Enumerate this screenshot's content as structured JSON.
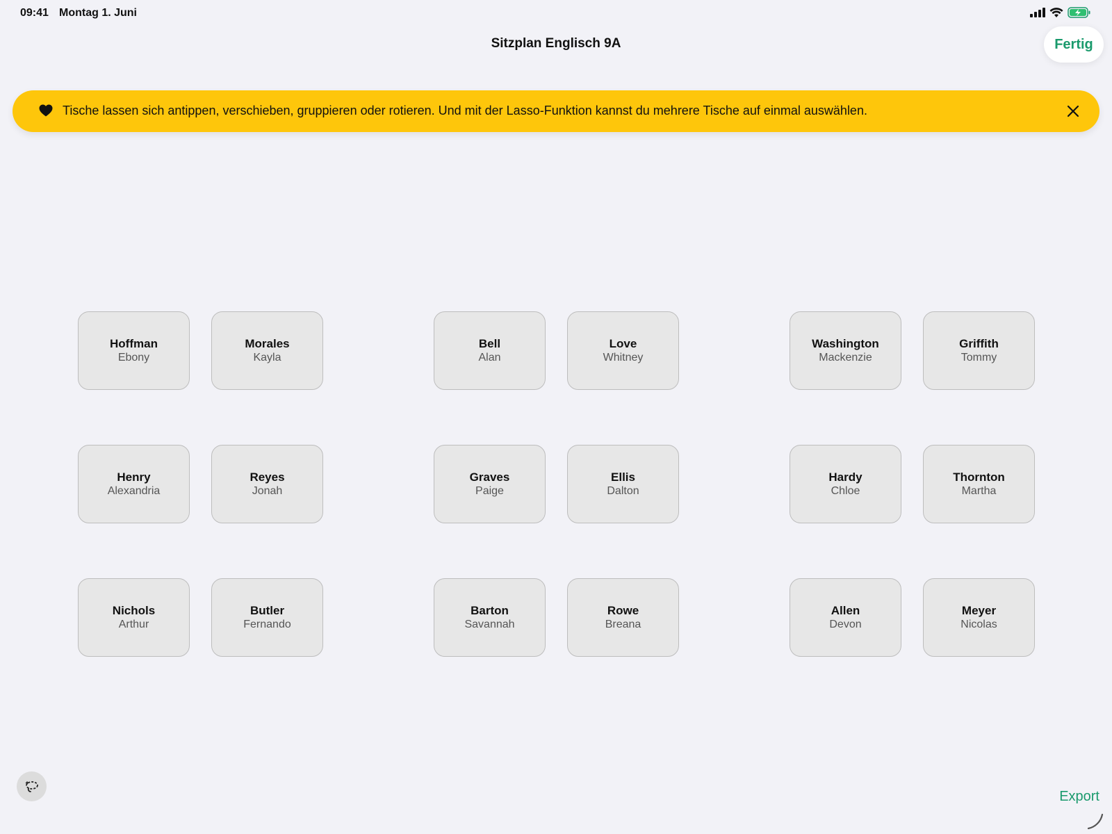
{
  "status_bar": {
    "time": "09:41",
    "date": "Montag 1. Juni"
  },
  "nav": {
    "title": "Sitzplan Englisch 9A",
    "done_label": "Fertig"
  },
  "banner": {
    "text": "Tische lassen sich antippen, verschieben, gruppieren oder rotieren. Und mit der Lasso-Funktion kannst du mehrere Tische auf einmal auswählen.",
    "background": "#fec60b"
  },
  "desks": [
    {
      "last": "Hoffman",
      "first": "Ebony"
    },
    {
      "last": "Morales",
      "first": "Kayla"
    },
    {
      "last": "Bell",
      "first": "Alan"
    },
    {
      "last": "Love",
      "first": "Whitney"
    },
    {
      "last": "Washington",
      "first": "Mackenzie"
    },
    {
      "last": "Griffith",
      "first": "Tommy"
    },
    {
      "last": "Henry",
      "first": "Alexandria"
    },
    {
      "last": "Reyes",
      "first": "Jonah"
    },
    {
      "last": "Graves",
      "first": "Paige"
    },
    {
      "last": "Ellis",
      "first": "Dalton"
    },
    {
      "last": "Hardy",
      "first": "Chloe"
    },
    {
      "last": "Thornton",
      "first": "Martha"
    },
    {
      "last": "Nichols",
      "first": "Arthur"
    },
    {
      "last": "Butler",
      "first": "Fernando"
    },
    {
      "last": "Barton",
      "first": "Savannah"
    },
    {
      "last": "Rowe",
      "first": "Breana"
    },
    {
      "last": "Allen",
      "first": "Devon"
    },
    {
      "last": "Meyer",
      "first": "Nicolas"
    }
  ],
  "bottom": {
    "export_label": "Export",
    "lasso_icon": "lasso-icon"
  },
  "colors": {
    "accent": "#1a9a6c",
    "desk_fill": "#e7e7e7",
    "desk_border": "#bdbdbd",
    "background": "#f2f2f7"
  }
}
